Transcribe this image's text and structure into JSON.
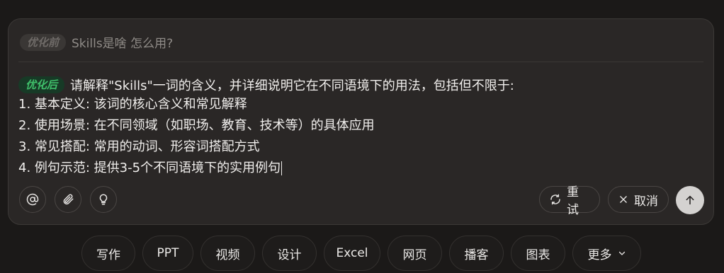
{
  "prompt_before": {
    "tag": "优化前",
    "text": "Skills是啥 怎么用?"
  },
  "prompt_after": {
    "tag": "优化后",
    "lines": [
      "请解释\"Skills\"一词的含义，并详细说明它在不同语境下的用法，包括但不限于:",
      "1. 基本定义: 该词的核心含义和常见解释",
      "2. 使用场景: 在不同领域（如职场、教育、技术等）的具体应用",
      "3. 常见搭配: 常用的动词、形容词搭配方式",
      "4. 例句示范: 提供3-5个不同语境下的实用例句"
    ]
  },
  "toolbar": {
    "mention_icon": "at-icon",
    "attach_icon": "paperclip-icon",
    "idea_icon": "lightbulb-icon",
    "retry_label": "重试",
    "cancel_label": "取消",
    "send_icon": "arrow-up-icon"
  },
  "quick_chips": [
    "写作",
    "PPT",
    "视频",
    "设计",
    "Excel",
    "网页",
    "播客",
    "图表",
    "更多"
  ],
  "colors": {
    "background": "#1b1918",
    "panel": "#2a2726",
    "tag_after_text": "#3fbf6a",
    "tag_after_bg": "#173a26",
    "send_button": "#d4d2d0"
  }
}
